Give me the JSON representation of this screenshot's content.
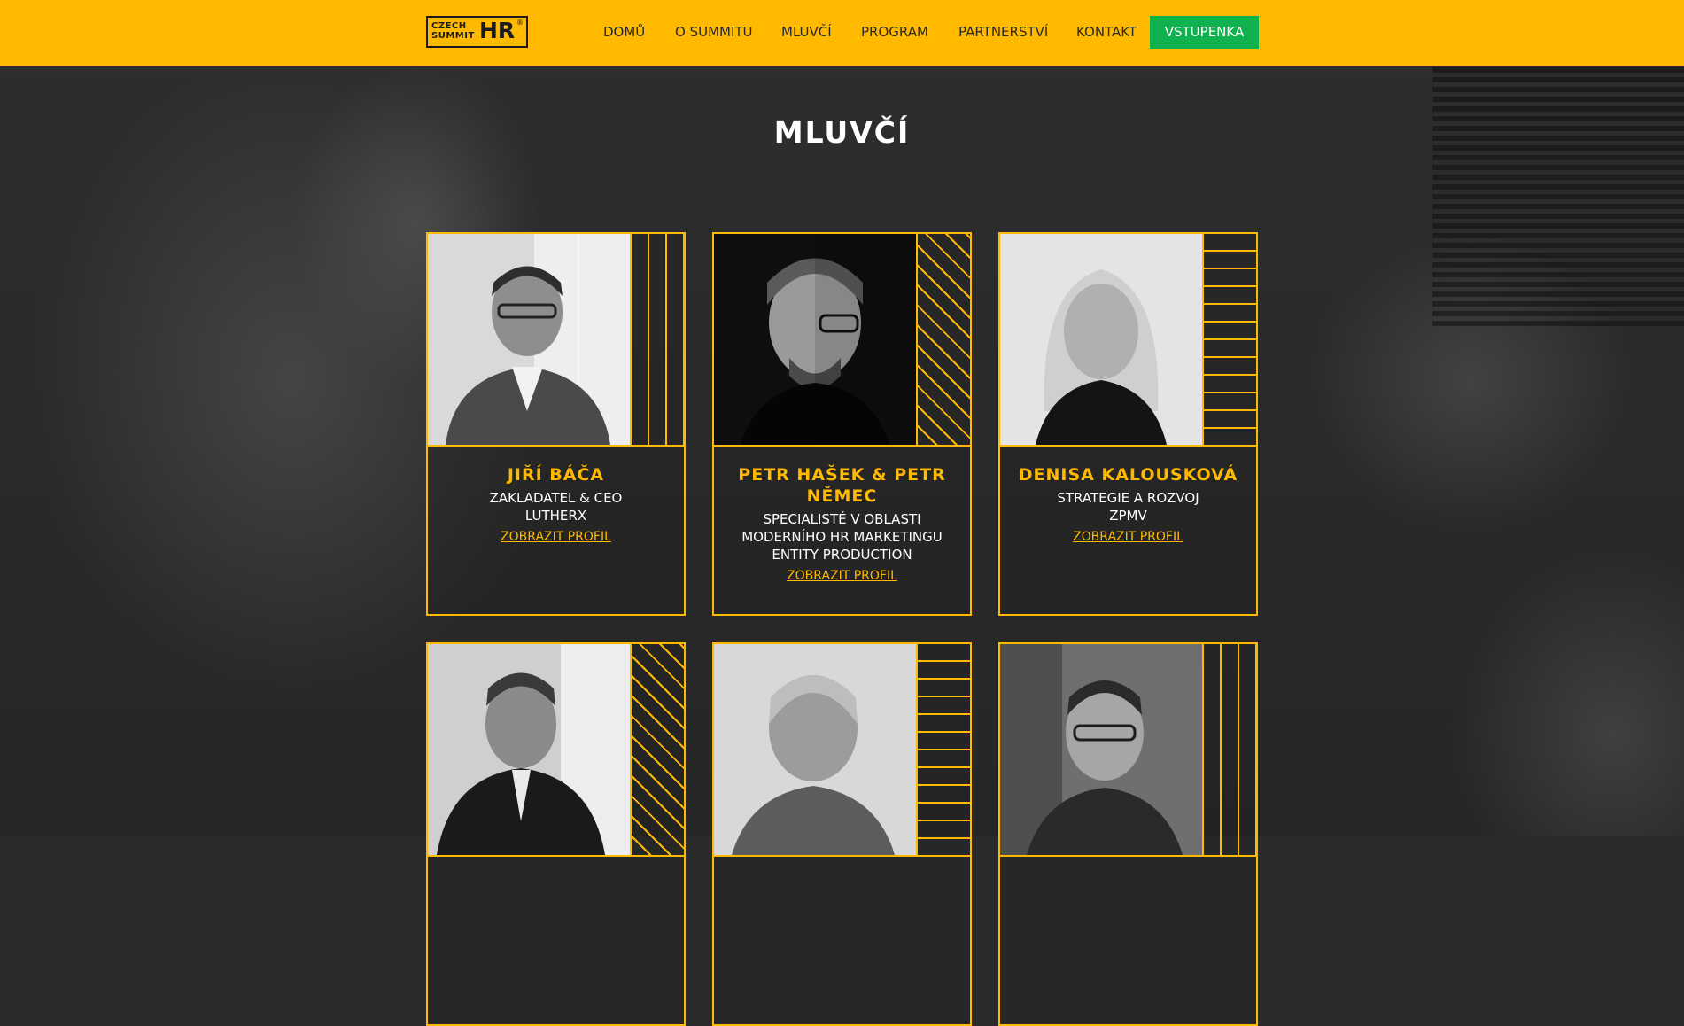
{
  "header": {
    "logo": {
      "line1": "CZECH",
      "line2": "SUMMIT",
      "mark": "HR",
      "registered": "®"
    },
    "nav": [
      "DOMŮ",
      "O SUMMITU",
      "MLUVČÍ",
      "PROGRAM",
      "PARTNERSTVÍ",
      "KONTAKT"
    ],
    "ticket_label": "VSTUPENKA"
  },
  "colors": {
    "accent": "#ffba00",
    "ticket": "#10b24f",
    "background": "#2b2b2b"
  },
  "page_title": "MLUVČÍ",
  "speakers": [
    {
      "name": "JIŘÍ BÁČA",
      "roles": [
        "ZAKLADATEL & CEO",
        "LUTHERX"
      ],
      "link": "ZOBRAZIT PROFIL",
      "pattern": "vertical-lines"
    },
    {
      "name": "PETR HAŠEK & PETR NĚMEC",
      "roles": [
        "SPECIALISTÉ V OBLASTI",
        "MODERNÍHO HR MARKETINGU",
        "ENTITY PRODUCTION"
      ],
      "link": "ZOBRAZIT PROFIL",
      "pattern": "diagonal-lines"
    },
    {
      "name": "DENISA KALOUSKOVÁ",
      "roles": [
        "STRATEGIE A ROZVOJ",
        "ZPMV"
      ],
      "link": "ZOBRAZIT PROFIL",
      "pattern": "horizontal-lines"
    },
    {
      "name": "",
      "roles": [],
      "link": "",
      "pattern": "diagonal-lines"
    },
    {
      "name": "",
      "roles": [],
      "link": "",
      "pattern": "horizontal-lines"
    },
    {
      "name": "",
      "roles": [],
      "link": "",
      "pattern": "vertical-lines"
    }
  ]
}
